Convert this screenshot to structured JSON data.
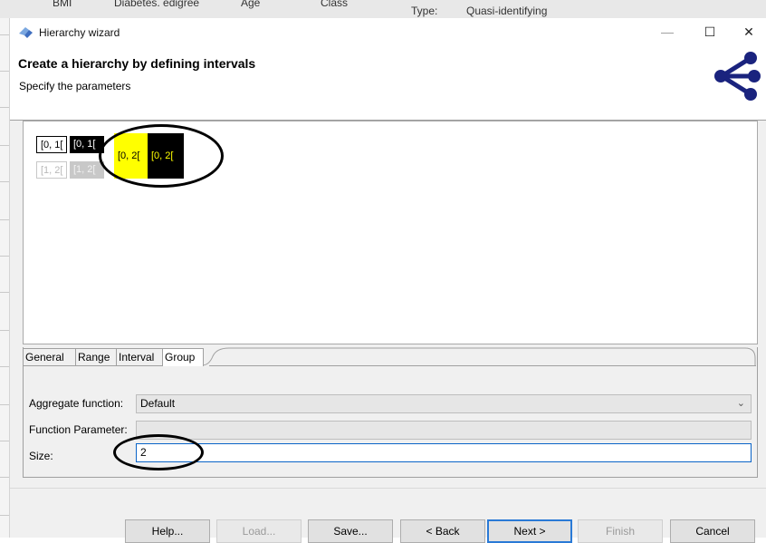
{
  "background": {
    "cells": [
      "BMI",
      "Diabetes. edigree",
      "Age",
      "Class",
      "Type:",
      "Quasi-identifying"
    ]
  },
  "window": {
    "title": "Hierarchy wizard",
    "minimize": "—",
    "maximize": "☐",
    "close": "✕"
  },
  "header": {
    "title": "Create a hierarchy by defining intervals",
    "subtitle": "Specify the parameters"
  },
  "preview": {
    "row1": [
      "[0, 1[",
      "[0, 1["
    ],
    "row2": [
      "[1, 2[",
      "[1, 2["
    ],
    "group": [
      "[0, 2[",
      "[0, 2["
    ]
  },
  "tabs": [
    "General",
    "Range",
    "Interval",
    "Group"
  ],
  "active_tab": "Group",
  "form": {
    "aggregate_label": "Aggregate function:",
    "aggregate_value": "Default",
    "param_label": "Function Parameter:",
    "param_value": "",
    "size_label": "Size:",
    "size_value": "2"
  },
  "buttons": {
    "help": "Help...",
    "load": "Load...",
    "save": "Save...",
    "back": "< Back",
    "next": "Next >",
    "finish": "Finish",
    "cancel": "Cancel"
  },
  "colors": {
    "accent": "#2a7ad6",
    "highlight": "#ffff00",
    "logo": "#1a237e"
  }
}
